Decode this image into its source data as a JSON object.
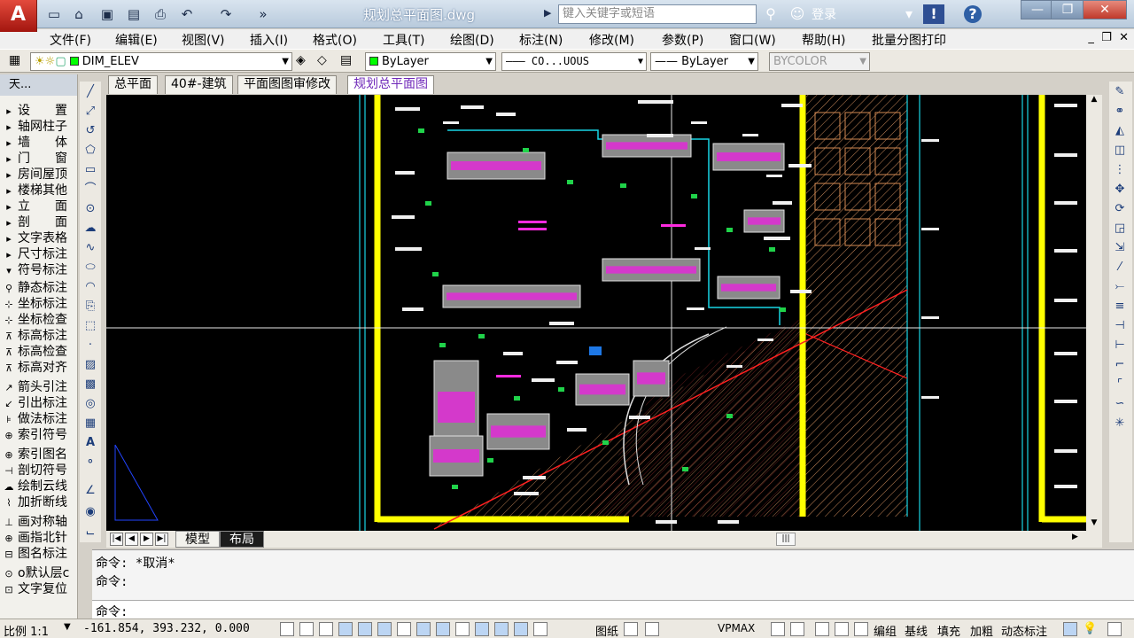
{
  "app": {
    "logo_letter": "A",
    "document_title": "规划总平面图.dwg"
  },
  "search": {
    "placeholder": "键入关键字或短语"
  },
  "user": {
    "login_label": "登录"
  },
  "menu": [
    "文件(F)",
    "编辑(E)",
    "视图(V)",
    "插入(I)",
    "格式(O)",
    "工具(T)",
    "绘图(D)",
    "标注(N)",
    "修改(M)",
    "参数(P)",
    "窗口(W)",
    "帮助(H)",
    "批量分图打印"
  ],
  "properties": {
    "layer": "DIM_ELEV",
    "color": "ByLayer",
    "linetype": "CO...UOUS",
    "lineweight": "ByLayer",
    "plotstyle": "BYCOLOR"
  },
  "panel": {
    "title": "天...",
    "items": [
      "设　　置",
      "轴网柱子",
      "墙　　体",
      "门　　窗",
      "房间屋顶",
      "楼梯其他",
      "立　　面",
      "剖　　面",
      "文字表格",
      "尺寸标注",
      "符号标注",
      "静态标注",
      "坐标标注",
      "坐标检查",
      "标高标注",
      "标高检查",
      "标高对齐",
      "箭头引注",
      "引出标注",
      "做法标注",
      "索引符号",
      "索引图名",
      "剖切符号",
      "绘制云线",
      "加折断线",
      "画对称轴",
      "画指北针",
      "图名标注",
      "o默认层c",
      "文字复位"
    ]
  },
  "tabs": [
    "总平面",
    "40#-建筑",
    "平面图图审修改",
    "规划总平面图"
  ],
  "active_tab": "规划总平面图",
  "layout_tabs": [
    "模型",
    "布局"
  ],
  "command": {
    "history": [
      "命令: *取消*",
      "命令:"
    ],
    "prompt": "命令:"
  },
  "status": {
    "scale": "比例 1:1",
    "coords": "-161.854, 393.232, 0.000",
    "paper": "图纸",
    "vpmax": "VPMAX",
    "quick": [
      "编组",
      "基线",
      "填充",
      "加粗",
      "动态标注"
    ]
  }
}
